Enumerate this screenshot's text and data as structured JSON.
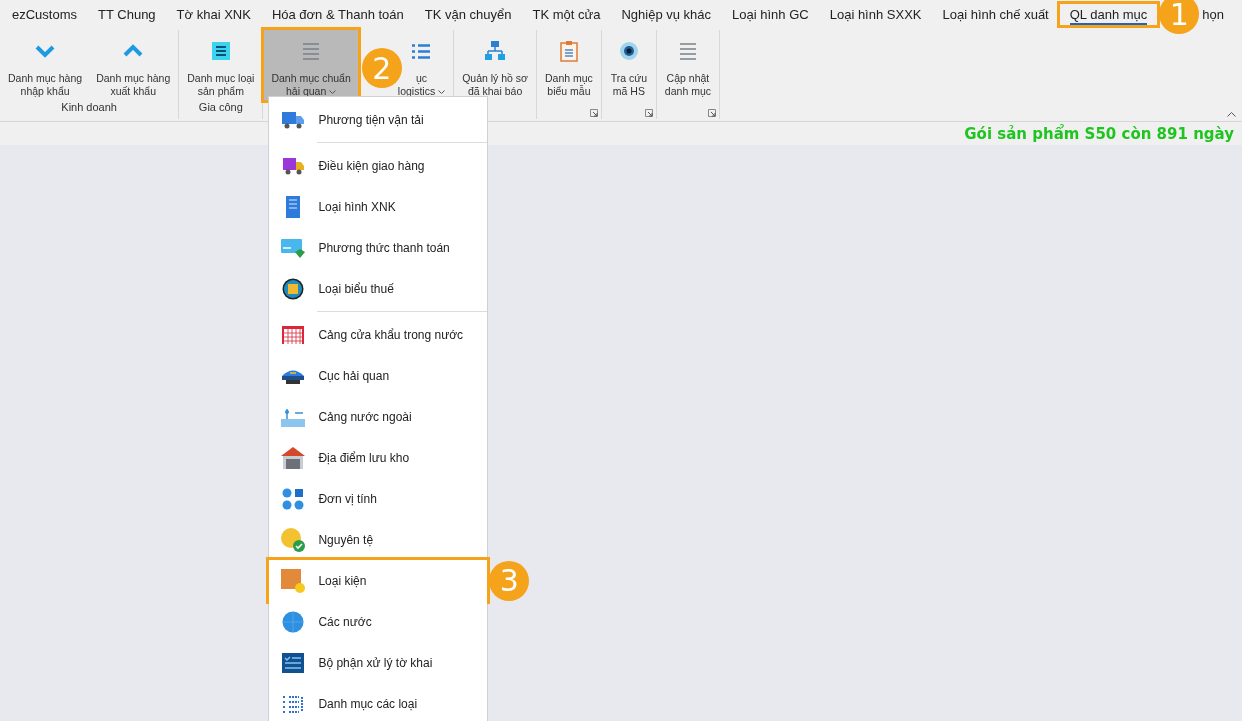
{
  "tabs": [
    {
      "label": "ezCustoms",
      "selected": false
    },
    {
      "label": "TT Chung",
      "selected": false
    },
    {
      "label": "Tờ khai XNK",
      "selected": false
    },
    {
      "label": "Hóa đơn & Thanh toán",
      "selected": false
    },
    {
      "label": "TK vận chuyển",
      "selected": false
    },
    {
      "label": "TK một cửa",
      "selected": false
    },
    {
      "label": "Nghiệp vụ khác",
      "selected": false
    },
    {
      "label": "Loại hình GC",
      "selected": false
    },
    {
      "label": "Loại hình SXXK",
      "selected": false
    },
    {
      "label": "Loại hình chế xuất",
      "selected": false
    },
    {
      "label": "QL danh mục",
      "selected": true,
      "callout": "1"
    },
    {
      "label": "họn",
      "selected": false
    }
  ],
  "ribbon": {
    "groups": [
      {
        "label": "Kinh doanh",
        "launcher": false,
        "buttons": [
          {
            "label": "Danh mục hàng\nnhập khẩu",
            "selected": false,
            "dropdown": false
          },
          {
            "label": "Danh mục hàng\nxuất khẩu",
            "selected": false,
            "dropdown": false
          }
        ]
      },
      {
        "label": "Gia công",
        "launcher": false,
        "buttons": [
          {
            "label": "Danh mục loại\nsản phẩm",
            "selected": false,
            "dropdown": false
          }
        ]
      },
      {
        "launcher": false,
        "buttons": [
          {
            "label": "Danh mục chuẩn\nhải quan",
            "selected": true,
            "dropdown": true,
            "callout": "2"
          },
          {
            "label": "ục\nlogistics",
            "selected": false,
            "dropdown": true
          }
        ]
      },
      {
        "launcher": false,
        "buttons": [
          {
            "label": "Quản lý hồ sơ\nđã khai báo",
            "selected": false,
            "dropdown": false
          }
        ]
      },
      {
        "launcher": true,
        "buttons": [
          {
            "label": "Danh mục\nbiểu mẫu",
            "selected": false,
            "dropdown": false
          }
        ]
      },
      {
        "launcher": true,
        "buttons": [
          {
            "label": "Tra cứu\nmã HS",
            "selected": false,
            "dropdown": false
          }
        ]
      },
      {
        "launcher": true,
        "buttons": [
          {
            "label": "Cập nhật\ndanh mục",
            "selected": false,
            "dropdown": false
          }
        ]
      }
    ]
  },
  "status": {
    "text": "Gói sản phẩm S50 còn 891 ngày"
  },
  "menu": {
    "sections": [
      [
        {
          "label": "Phương tiện vận tải",
          "selected": false
        }
      ],
      [
        {
          "label": "Điều kiện giao hàng",
          "selected": false
        },
        {
          "label": "Loại hình XNK",
          "selected": false
        },
        {
          "label": "Phương thức thanh toán",
          "selected": false
        },
        {
          "label": "Loại biểu thuế",
          "selected": false
        }
      ],
      [
        {
          "label": "Cảng cửa khẩu trong nước",
          "selected": false
        },
        {
          "label": "Cục hải quan",
          "selected": false
        },
        {
          "label": "Cảng nước ngoài",
          "selected": false
        },
        {
          "label": "Địa điểm lưu kho",
          "selected": false
        },
        {
          "label": "Đơn vị tính",
          "selected": false
        },
        {
          "label": "Nguyên tệ",
          "selected": false
        },
        {
          "label": "Loại kiện",
          "selected": true,
          "callout": "3"
        },
        {
          "label": "Các nước",
          "selected": false
        },
        {
          "label": "Bộ phận xử lý tờ khai",
          "selected": false
        },
        {
          "label": "Danh mục các loại",
          "selected": false
        }
      ]
    ]
  }
}
